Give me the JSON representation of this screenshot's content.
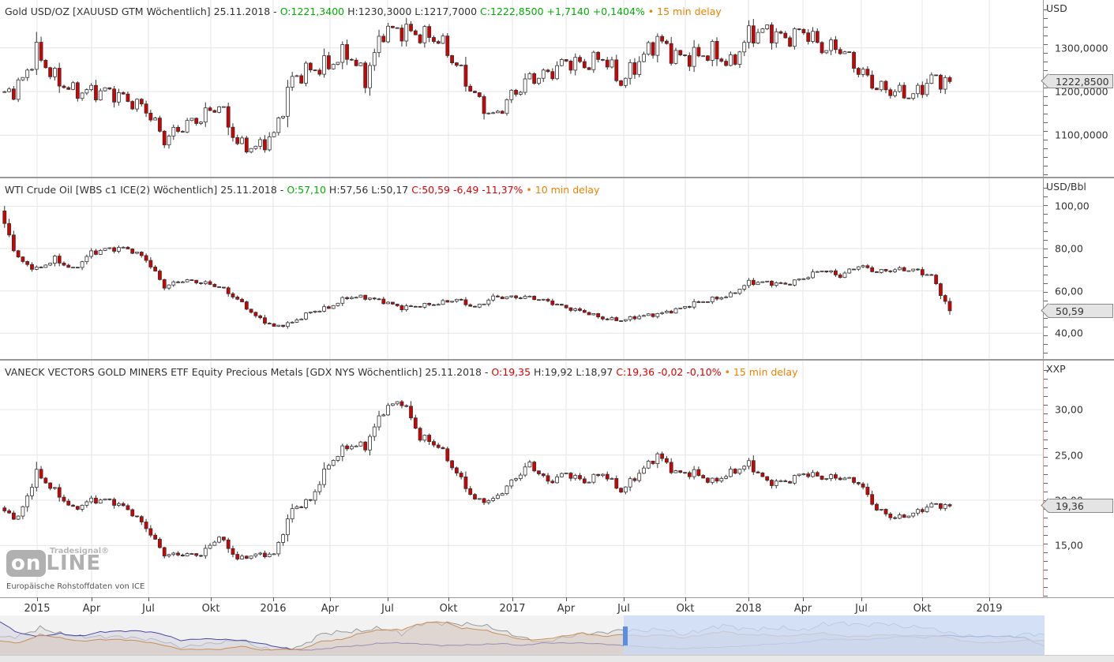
{
  "time_axis": {
    "labels": [
      "2015",
      "Apr",
      "Jul",
      "Okt",
      "2016",
      "Apr",
      "Jul",
      "Okt",
      "2017",
      "Apr",
      "Jul",
      "Okt",
      "2018",
      "Apr",
      "Jul",
      "Okt",
      "2019"
    ]
  },
  "watermark": {
    "logo_small": "Tradesignal®",
    "logo_text": "onLine",
    "source": "Europäische Rohstoffdaten von ICE"
  },
  "colors": {
    "up_fill": "#ffffff",
    "down_fill": "#d40000",
    "wick": "#333333",
    "grid": "#e6e6e6",
    "positive": "#00b000",
    "negative": "#e00000",
    "delay": "#f08000",
    "nav_selection": "#c9d9f5"
  },
  "chart_data": [
    {
      "type": "candlestick",
      "title": "Gold USD/OZ [XAUUSD GTM Wöchentlich] 25.11.2018 -",
      "open": "O:1221,3400",
      "hl": "H:1230,3000 L:1217,7000",
      "close": "C:1222,8500 +1,7140 +0,1404%",
      "delay": "• 15 min delay",
      "unit": "USD",
      "ylim": [
        1030,
        1370
      ],
      "yticks": [
        {
          "v": 1300,
          "label": "1300,0000"
        },
        {
          "v": 1200,
          "label": "1200,0000"
        },
        {
          "v": 1100,
          "label": "1100,0000"
        }
      ],
      "last": 1222.85,
      "last_label": "1222,8500",
      "period": "4-weekly closes, Nov 2014 – Nov 2018",
      "closes": [
        1190,
        1210,
        1290,
        1230,
        1200,
        1200,
        1200,
        1180,
        1160,
        1090,
        1120,
        1140,
        1170,
        1080,
        1070,
        1100,
        1230,
        1250,
        1260,
        1290,
        1230,
        1340,
        1340,
        1330,
        1320,
        1260,
        1190,
        1140,
        1190,
        1230,
        1240,
        1270,
        1260,
        1280,
        1220,
        1270,
        1320,
        1280,
        1280,
        1290,
        1260,
        1330,
        1340,
        1320,
        1340,
        1300,
        1300,
        1250,
        1210,
        1200,
        1190,
        1230,
        1222.85
      ]
    },
    {
      "type": "candlestick",
      "title": "WTI Crude Oil [WBS c1 ICE(2) Wöchentlich] 25.11.2018 -",
      "open": "O:57,10",
      "hl": "H:57,56 L:50,17",
      "close": "C:50,59 -6,49 -11,37%",
      "delay": "• 10 min delay",
      "unit": "USD/Bbl",
      "ylim": [
        33,
        105
      ],
      "yticks": [
        {
          "v": 100,
          "label": "100,00"
        },
        {
          "v": 80,
          "label": "80,00"
        },
        {
          "v": 60,
          "label": "60,00"
        },
        {
          "v": 40,
          "label": "40,00"
        }
      ],
      "last": 50.59,
      "last_label": "50,59",
      "period": "4-weekly closes, Nov 2014 – Nov 2018",
      "closes": [
        97,
        75,
        70,
        75,
        70,
        78,
        80,
        80,
        75,
        62,
        65,
        64,
        62,
        56,
        48,
        43,
        45,
        50,
        52,
        57,
        57,
        55,
        52,
        53,
        54,
        56,
        52,
        57,
        57,
        57,
        55,
        52,
        50,
        47,
        46,
        48,
        49,
        51,
        54,
        56,
        58,
        64,
        64,
        63,
        66,
        70,
        67,
        72,
        69,
        70,
        70,
        67,
        50.59
      ]
    },
    {
      "type": "candlestick",
      "title": "VANECK VECTORS GOLD MINERS ETF Equity Precious Metals [GDX NYS Wöchentlich] 25.11.2018 -",
      "open": "O:19,35",
      "hl": "H:19,92 L:18,97",
      "close": "C:19,36 -0,02 -0,10%",
      "delay": "• 15 min delay",
      "unit": "XXP",
      "ylim": [
        10.5,
        33.5
      ],
      "yticks": [
        {
          "v": 30,
          "label": "30,00"
        },
        {
          "v": 25,
          "label": "25,00"
        },
        {
          "v": 20,
          "label": "20,00"
        },
        {
          "v": 15,
          "label": "15,00"
        }
      ],
      "last": 19.36,
      "last_label": "19,36",
      "period": "4-weekly closes, Nov 2014 – Nov 2018",
      "closes": [
        19,
        18,
        23,
        21,
        19,
        20,
        20,
        19,
        17,
        14,
        14,
        14,
        16,
        13.5,
        14,
        14,
        19,
        20,
        24,
        26,
        26,
        30,
        31,
        27,
        26,
        23,
        20,
        20,
        22,
        24,
        22,
        23,
        22,
        23,
        21,
        23,
        25,
        23,
        23,
        22,
        23,
        24,
        22,
        22,
        23,
        22.5,
        22.5,
        22,
        19,
        18,
        18.5,
        19.5,
        19.36
      ]
    }
  ]
}
